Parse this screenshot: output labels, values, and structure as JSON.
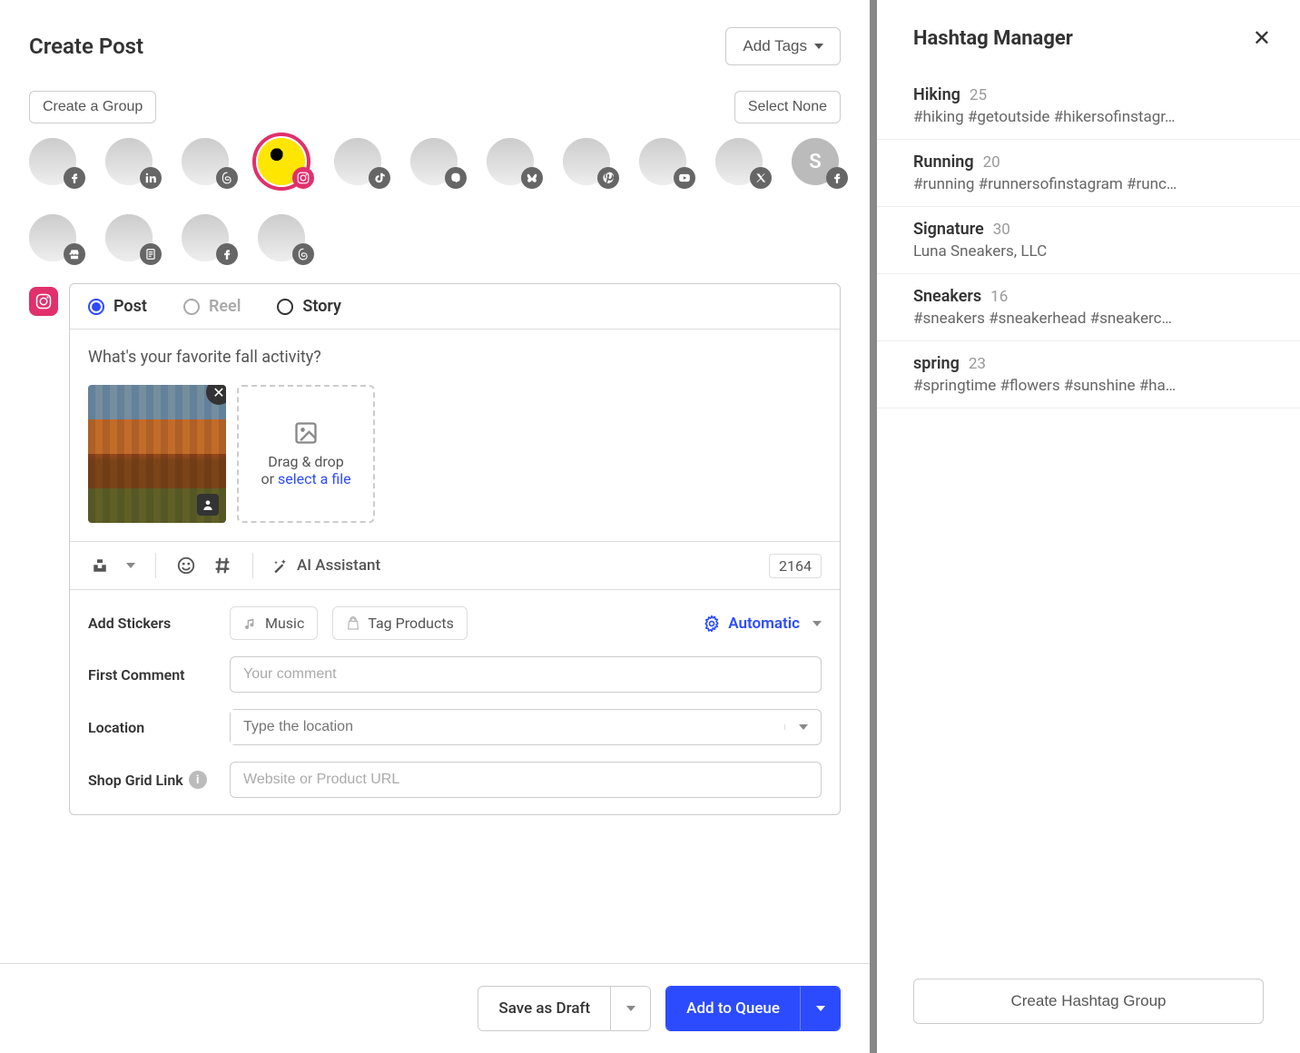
{
  "header": {
    "title": "Create Post",
    "add_tags": "Add Tags"
  },
  "groups": {
    "create": "Create a Group",
    "select_none": "Select None"
  },
  "channels": [
    {
      "network": "facebook",
      "selected": false
    },
    {
      "network": "linkedin",
      "selected": false
    },
    {
      "network": "threads",
      "selected": false
    },
    {
      "network": "instagram",
      "selected": true
    },
    {
      "network": "tiktok",
      "selected": false
    },
    {
      "network": "mastodon",
      "selected": false
    },
    {
      "network": "bluesky",
      "selected": false
    },
    {
      "network": "pinterest",
      "selected": false
    },
    {
      "network": "youtube",
      "selected": false
    },
    {
      "network": "x",
      "selected": false
    },
    {
      "network": "facebook",
      "selected": false,
      "initial": "S"
    },
    {
      "network": "googlebusiness",
      "selected": false
    },
    {
      "network": "startpage",
      "selected": false
    },
    {
      "network": "facebook",
      "selected": false
    },
    {
      "network": "threads",
      "selected": false
    }
  ],
  "composer": {
    "types": {
      "post": "Post",
      "reel": "Reel",
      "story": "Story"
    },
    "selected_type": "post",
    "text": "What's your favorite fall activity?",
    "upload": {
      "drag": "Drag & drop",
      "or": "or ",
      "select": "select a file"
    },
    "ai": "AI Assistant",
    "char_count": "2164"
  },
  "options": {
    "add_stickers": "Add Stickers",
    "music": "Music",
    "tag_products": "Tag Products",
    "automatic": "Automatic",
    "first_comment": "First Comment",
    "first_comment_ph": "Your comment",
    "location": "Location",
    "location_ph": "Type the location",
    "shop_grid": "Shop Grid Link",
    "shop_grid_ph": "Website or Product URL"
  },
  "footer": {
    "save_draft": "Save as Draft",
    "add_queue": "Add to Queue"
  },
  "sidebar": {
    "title": "Hashtag Manager",
    "groups": [
      {
        "name": "Hiking",
        "count": "25",
        "tags": "#hiking #getoutside #hikersofinstagr…"
      },
      {
        "name": "Running",
        "count": "20",
        "tags": "#running #runnersofinstagram #runc…"
      },
      {
        "name": "Signature",
        "count": "30",
        "tags": "Luna Sneakers, LLC"
      },
      {
        "name": "Sneakers",
        "count": "16",
        "tags": "#sneakers #sneakerhead #sneakerc…"
      },
      {
        "name": "spring",
        "count": "23",
        "tags": "#springtime #flowers #sunshine #ha…"
      }
    ],
    "create": "Create Hashtag Group"
  }
}
